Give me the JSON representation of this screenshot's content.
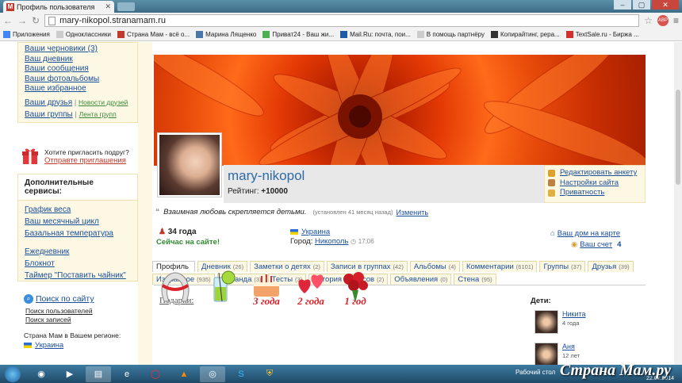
{
  "browser": {
    "tab_title": "Профиль пользователя",
    "tab_favicon": "M",
    "url": "mary-nikopol.stranamam.ru",
    "bookmarks": [
      {
        "label": "Приложения",
        "icon": "apps-grid-icon",
        "color": "#4285f4"
      },
      {
        "label": "Одноклассники",
        "icon": "page-icon",
        "color": "#cccccc"
      },
      {
        "label": "Страна Мам - всё о...",
        "icon": "stranamam-icon",
        "color": "#c0392b"
      },
      {
        "label": "Марина Лященко",
        "icon": "vk-icon",
        "color": "#4a76a8"
      },
      {
        "label": "Приват24 - Ваш жи...",
        "icon": "privat-icon",
        "color": "#4caf50"
      },
      {
        "label": "Mail.Ru: почта, пои...",
        "icon": "mailru-icon",
        "color": "#1e5aa8"
      },
      {
        "label": "В помощь партнёру",
        "icon": "page-icon",
        "color": "#cccccc"
      },
      {
        "label": "Копирайтинг, рера...",
        "icon": "a-icon",
        "color": "#333333"
      },
      {
        "label": "TextSale.ru - Биржа ...",
        "icon": "textsale-icon",
        "color": "#d32f2f"
      }
    ]
  },
  "left": {
    "top_links": [
      "Ваши черновики (3)",
      "Ваш дневник",
      "Ваши сообщения",
      "Ваши фотоальбомы",
      "Ваше избранное"
    ],
    "friends": "Ваши друзья",
    "friends_news": "Новости друзей",
    "groups": "Ваши группы",
    "groups_feed": "Лента групп",
    "invite_q": "Хотите пригласить подруг?",
    "invite_link": "Отправте приглашения",
    "services_title": "Дополнительные сервисы:",
    "services": [
      "График веса",
      "Ваш месячный цикл",
      "Базальная температура"
    ],
    "services2": [
      "Ежедневник",
      "Блокнот",
      "Таймер \"Поставить чайник\""
    ],
    "search_link": "Поиск по сайту",
    "search_users": "Поиск пользователей",
    "search_posts": "Поиск записей",
    "region_label": "Страна Мам в Вашем регионе:",
    "region": "Украина"
  },
  "profile": {
    "username": "mary-nikopol",
    "rating_label": "Рейтинг:",
    "rating": "+10000",
    "actions": [
      {
        "label": "Редактировать анкету",
        "icon": "pencil-icon",
        "color": "#e0a030"
      },
      {
        "label": "Настройки сайта",
        "icon": "gear-icon",
        "color": "#c08040"
      },
      {
        "label": "Приватность",
        "icon": "lock-icon",
        "color": "#e0b040"
      }
    ],
    "motto": "Взаимная любовь скрепляется детьми.",
    "motto_meta": "(установлен 41 месяц назад)",
    "motto_edit": "Изменить",
    "age": "34 года",
    "online": "Сейчас на сайте!",
    "country": "Украина",
    "city_label": "Город:",
    "city": "Никополь",
    "time": "17:06",
    "home_map": "Ваш дом на карте",
    "account": "Ваш счет",
    "account_val": "4"
  },
  "tabs_row1": [
    {
      "label": "Профиль",
      "count": ""
    },
    {
      "label": "Дневник",
      "count": "(26)"
    },
    {
      "label": "Заметки о детях",
      "count": "(2)"
    },
    {
      "label": "Записи в группах",
      "count": "(42)"
    },
    {
      "label": "Альбомы",
      "count": "(4)"
    },
    {
      "label": "Комментарии",
      "count": "(6101)"
    },
    {
      "label": "Группы",
      "count": "(37)"
    },
    {
      "label": "Друзья",
      "count": "(39)"
    }
  ],
  "tabs_row2": [
    {
      "label": "Избранное",
      "count": "(935)"
    },
    {
      "label": "Команда",
      "count": "(3)"
    },
    {
      "label": "Тесты",
      "count": "(3)"
    },
    {
      "label": "История статусов",
      "count": "(2)"
    },
    {
      "label": "Объявления",
      "count": "(0)"
    },
    {
      "label": "Стена",
      "count": "(95)"
    }
  ],
  "gifts": {
    "title": "Подарки:",
    "items": [
      {
        "name": "horseshoe-icon",
        "caption": ""
      },
      {
        "name": "cocktail-icon",
        "caption": ""
      },
      {
        "name": "cake-icon",
        "caption": "3 года"
      },
      {
        "name": "hearts-icon",
        "caption": "2 года"
      },
      {
        "name": "roses-icon",
        "caption": "1 год"
      }
    ]
  },
  "kids": {
    "title": "Дети:",
    "list": [
      {
        "name": "Никита",
        "age": "4 года"
      },
      {
        "name": "Аня",
        "age": "12 лет"
      }
    ]
  },
  "taskbar": {
    "watermark": "Страна Мам.ру",
    "tray_text": "Рабочий стол",
    "date": "22.02.2014"
  }
}
